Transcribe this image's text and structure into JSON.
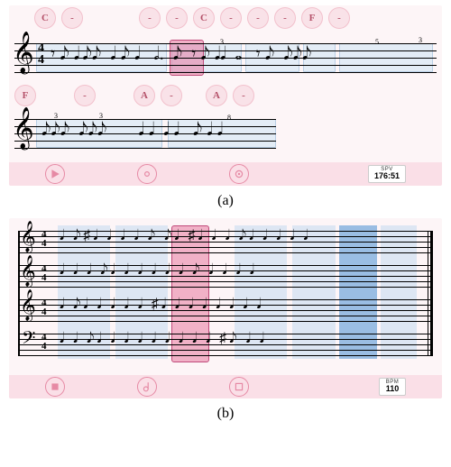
{
  "panel_a": {
    "caption": "(a)",
    "chord_row1": [
      "C",
      "-",
      "",
      "-",
      "-",
      "C",
      "-",
      "-",
      "-",
      "F",
      "-"
    ],
    "chord_row2": [
      "F",
      "",
      "-",
      "",
      "A",
      "-",
      "",
      "A",
      "-"
    ],
    "time_signature": {
      "top": "4",
      "bottom": "4"
    },
    "tuplet_labels": [
      "3",
      "5",
      "3",
      "3",
      "3",
      "8"
    ],
    "toolbar": {
      "play_label": "play",
      "record_label": "record",
      "settings_label": "settings",
      "bpm_label": "SPV",
      "bpm_unit": "176:51"
    }
  },
  "panel_b": {
    "caption": "(b)",
    "time_signature": {
      "top": "4",
      "bottom": "4"
    },
    "toolbar": {
      "stop_label": "stop",
      "tempo_label": "tempo",
      "settings_label": "settings",
      "bpm_label": "BPM",
      "bpm_value": "110"
    }
  },
  "chart_data": [
    {
      "type": "table",
      "title": "Panel (a) — single-staff melody with chord labels",
      "staff_count": 1,
      "clefs": [
        "treble"
      ],
      "time_signature": "4/4",
      "systems": 2,
      "chord_progression_system1": [
        "C",
        "-",
        "-",
        "-",
        "C",
        "-",
        "-",
        "-",
        "F",
        "-"
      ],
      "chord_progression_system2": [
        "F",
        "-",
        "A",
        "-",
        "A",
        "-"
      ],
      "current_playhead_measure": 3,
      "highlight_color": "pink",
      "tuplets": [
        3,
        5,
        3,
        3,
        3,
        8
      ]
    },
    {
      "type": "table",
      "title": "Panel (b) — four-part score (SATB)",
      "staff_count": 4,
      "clefs": [
        "treble",
        "treble",
        "treble",
        "bass"
      ],
      "time_signature": "4/4",
      "measures": 6,
      "highlighted_measures": {
        "faint_blue": [
          1,
          2,
          4,
          5
        ],
        "pink_current": [
          3
        ],
        "strong_blue": [
          5
        ]
      }
    }
  ]
}
